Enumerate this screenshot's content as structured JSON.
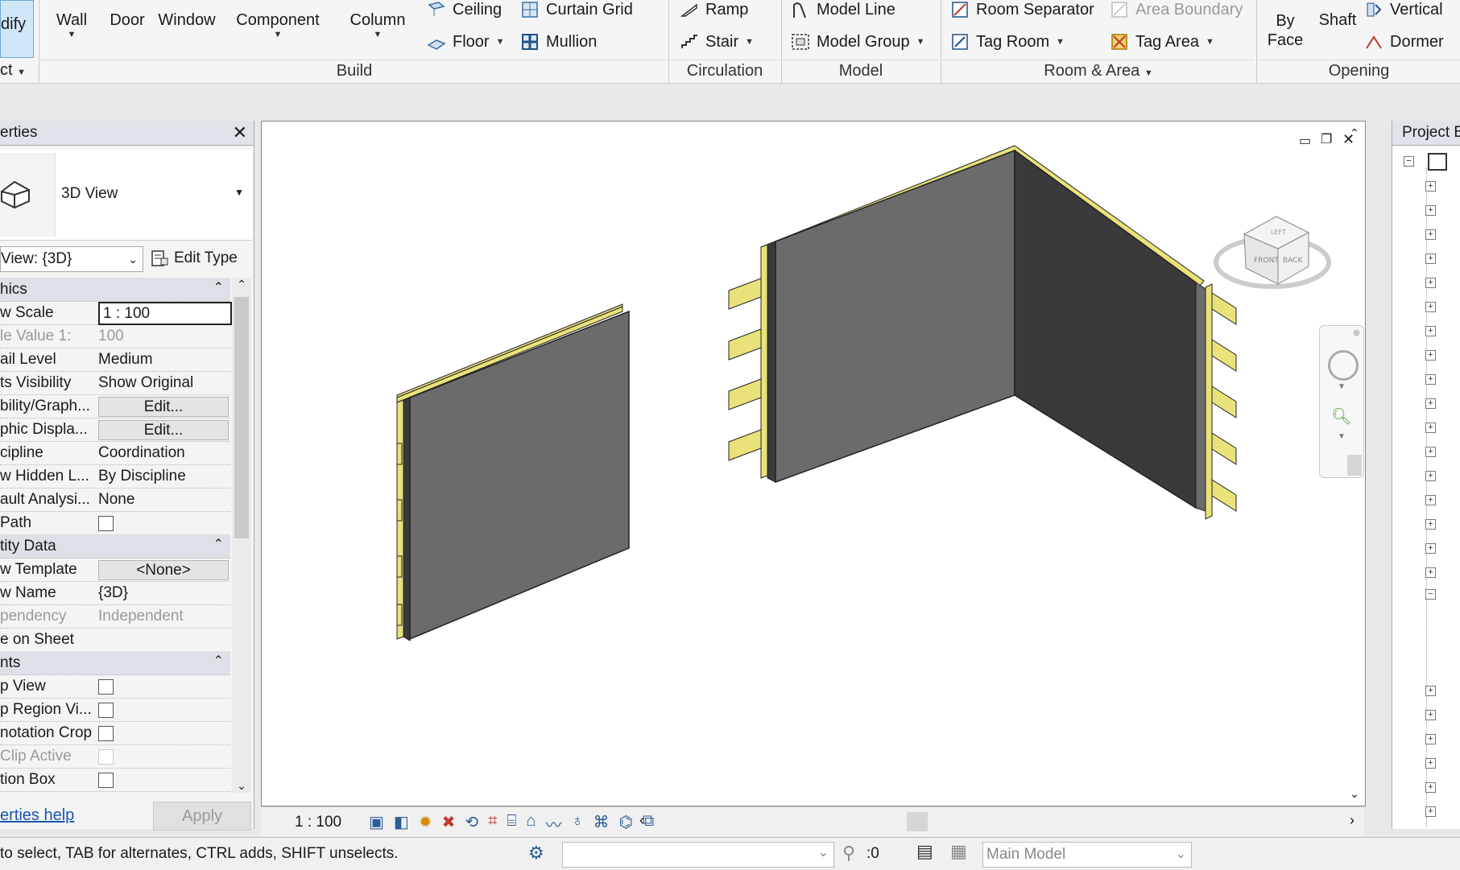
{
  "ribbon": {
    "modify_label": "dify",
    "wall": "Wall",
    "door": "Door",
    "window": "Window",
    "component": "Component",
    "column": "Column",
    "ceiling": "Ceiling",
    "floor": "Floor",
    "curtain_grid": "Curtain Grid",
    "mullion": "Mullion",
    "ramp": "Ramp",
    "stair": "Stair",
    "model_line": "Model Line",
    "model_group": "Model Group",
    "room_separator": "Room Separator",
    "tag_room": "Tag Room",
    "area_boundary": "Area Boundary",
    "tag_area": "Tag Area",
    "by_face": "By\nFace",
    "by": "By",
    "face": "Face",
    "shaft": "Shaft",
    "vertical": "Vertical",
    "dormer": "Dormer",
    "select_label": "ct",
    "panels": {
      "build": "Build",
      "circulation": "Circulation",
      "model": "Model",
      "room_area": "Room & Area",
      "opening": "Opening"
    }
  },
  "properties": {
    "title": "erties",
    "type_name": "3D View",
    "view_selector": "View: {3D}",
    "edit_type": "Edit Type",
    "groups": {
      "graphics": "hics",
      "identity": "tity Data",
      "extents": "nts"
    },
    "rows": {
      "view_scale": {
        "k": "w Scale",
        "v": "1 : 100"
      },
      "scale_value": {
        "k": "le Value   1:",
        "v": "100"
      },
      "detail_level": {
        "k": "ail Level",
        "v": "Medium"
      },
      "parts_visibility": {
        "k": "ts Visibility",
        "v": "Show Original"
      },
      "visibility": {
        "k": "bility/Graph...",
        "v": "Edit..."
      },
      "graphic_display": {
        "k": "phic Displa...",
        "v": "Edit..."
      },
      "discipline": {
        "k": "cipline",
        "v": "Coordination"
      },
      "hidden_lines": {
        "k": "w Hidden L...",
        "v": "By Discipline"
      },
      "analysis": {
        "k": "ault Analysi...",
        "v": "None"
      },
      "sun_path": {
        "k": " Path",
        "v": ""
      },
      "view_template": {
        "k": "w Template",
        "v": "<None>"
      },
      "view_name": {
        "k": "w Name",
        "v": "{3D}"
      },
      "dependency": {
        "k": "pendency",
        "v": "Independent"
      },
      "title_on_sheet": {
        "k": "e on Sheet",
        "v": ""
      },
      "crop_view": {
        "k": "p View",
        "v": ""
      },
      "crop_region": {
        "k": "p Region Vi...",
        "v": ""
      },
      "annotation_crop": {
        "k": "notation Crop",
        "v": ""
      },
      "far_clip": {
        "k": " Clip Active",
        "v": ""
      },
      "section_box": {
        "k": "tion Box",
        "v": ""
      }
    },
    "help_link": "erties help",
    "apply": "Apply"
  },
  "view": {
    "scale": "1 : 100",
    "viewcube_faces": [
      "LEFT",
      "FRONT",
      "BACK"
    ]
  },
  "browser": {
    "title": "Project B"
  },
  "status": {
    "hint": "to select, TAB for alternates, CTRL adds, SHIFT unselects.",
    "count": ":0",
    "workset": "Main Model"
  },
  "colors": {
    "wall_face": "#6b6b6b",
    "wall_dark": "#3a3a3a",
    "stud_yellow": "#e9e27a",
    "ribbon_bg": "#f5f5f5",
    "panel_header": "#dde0e6"
  }
}
